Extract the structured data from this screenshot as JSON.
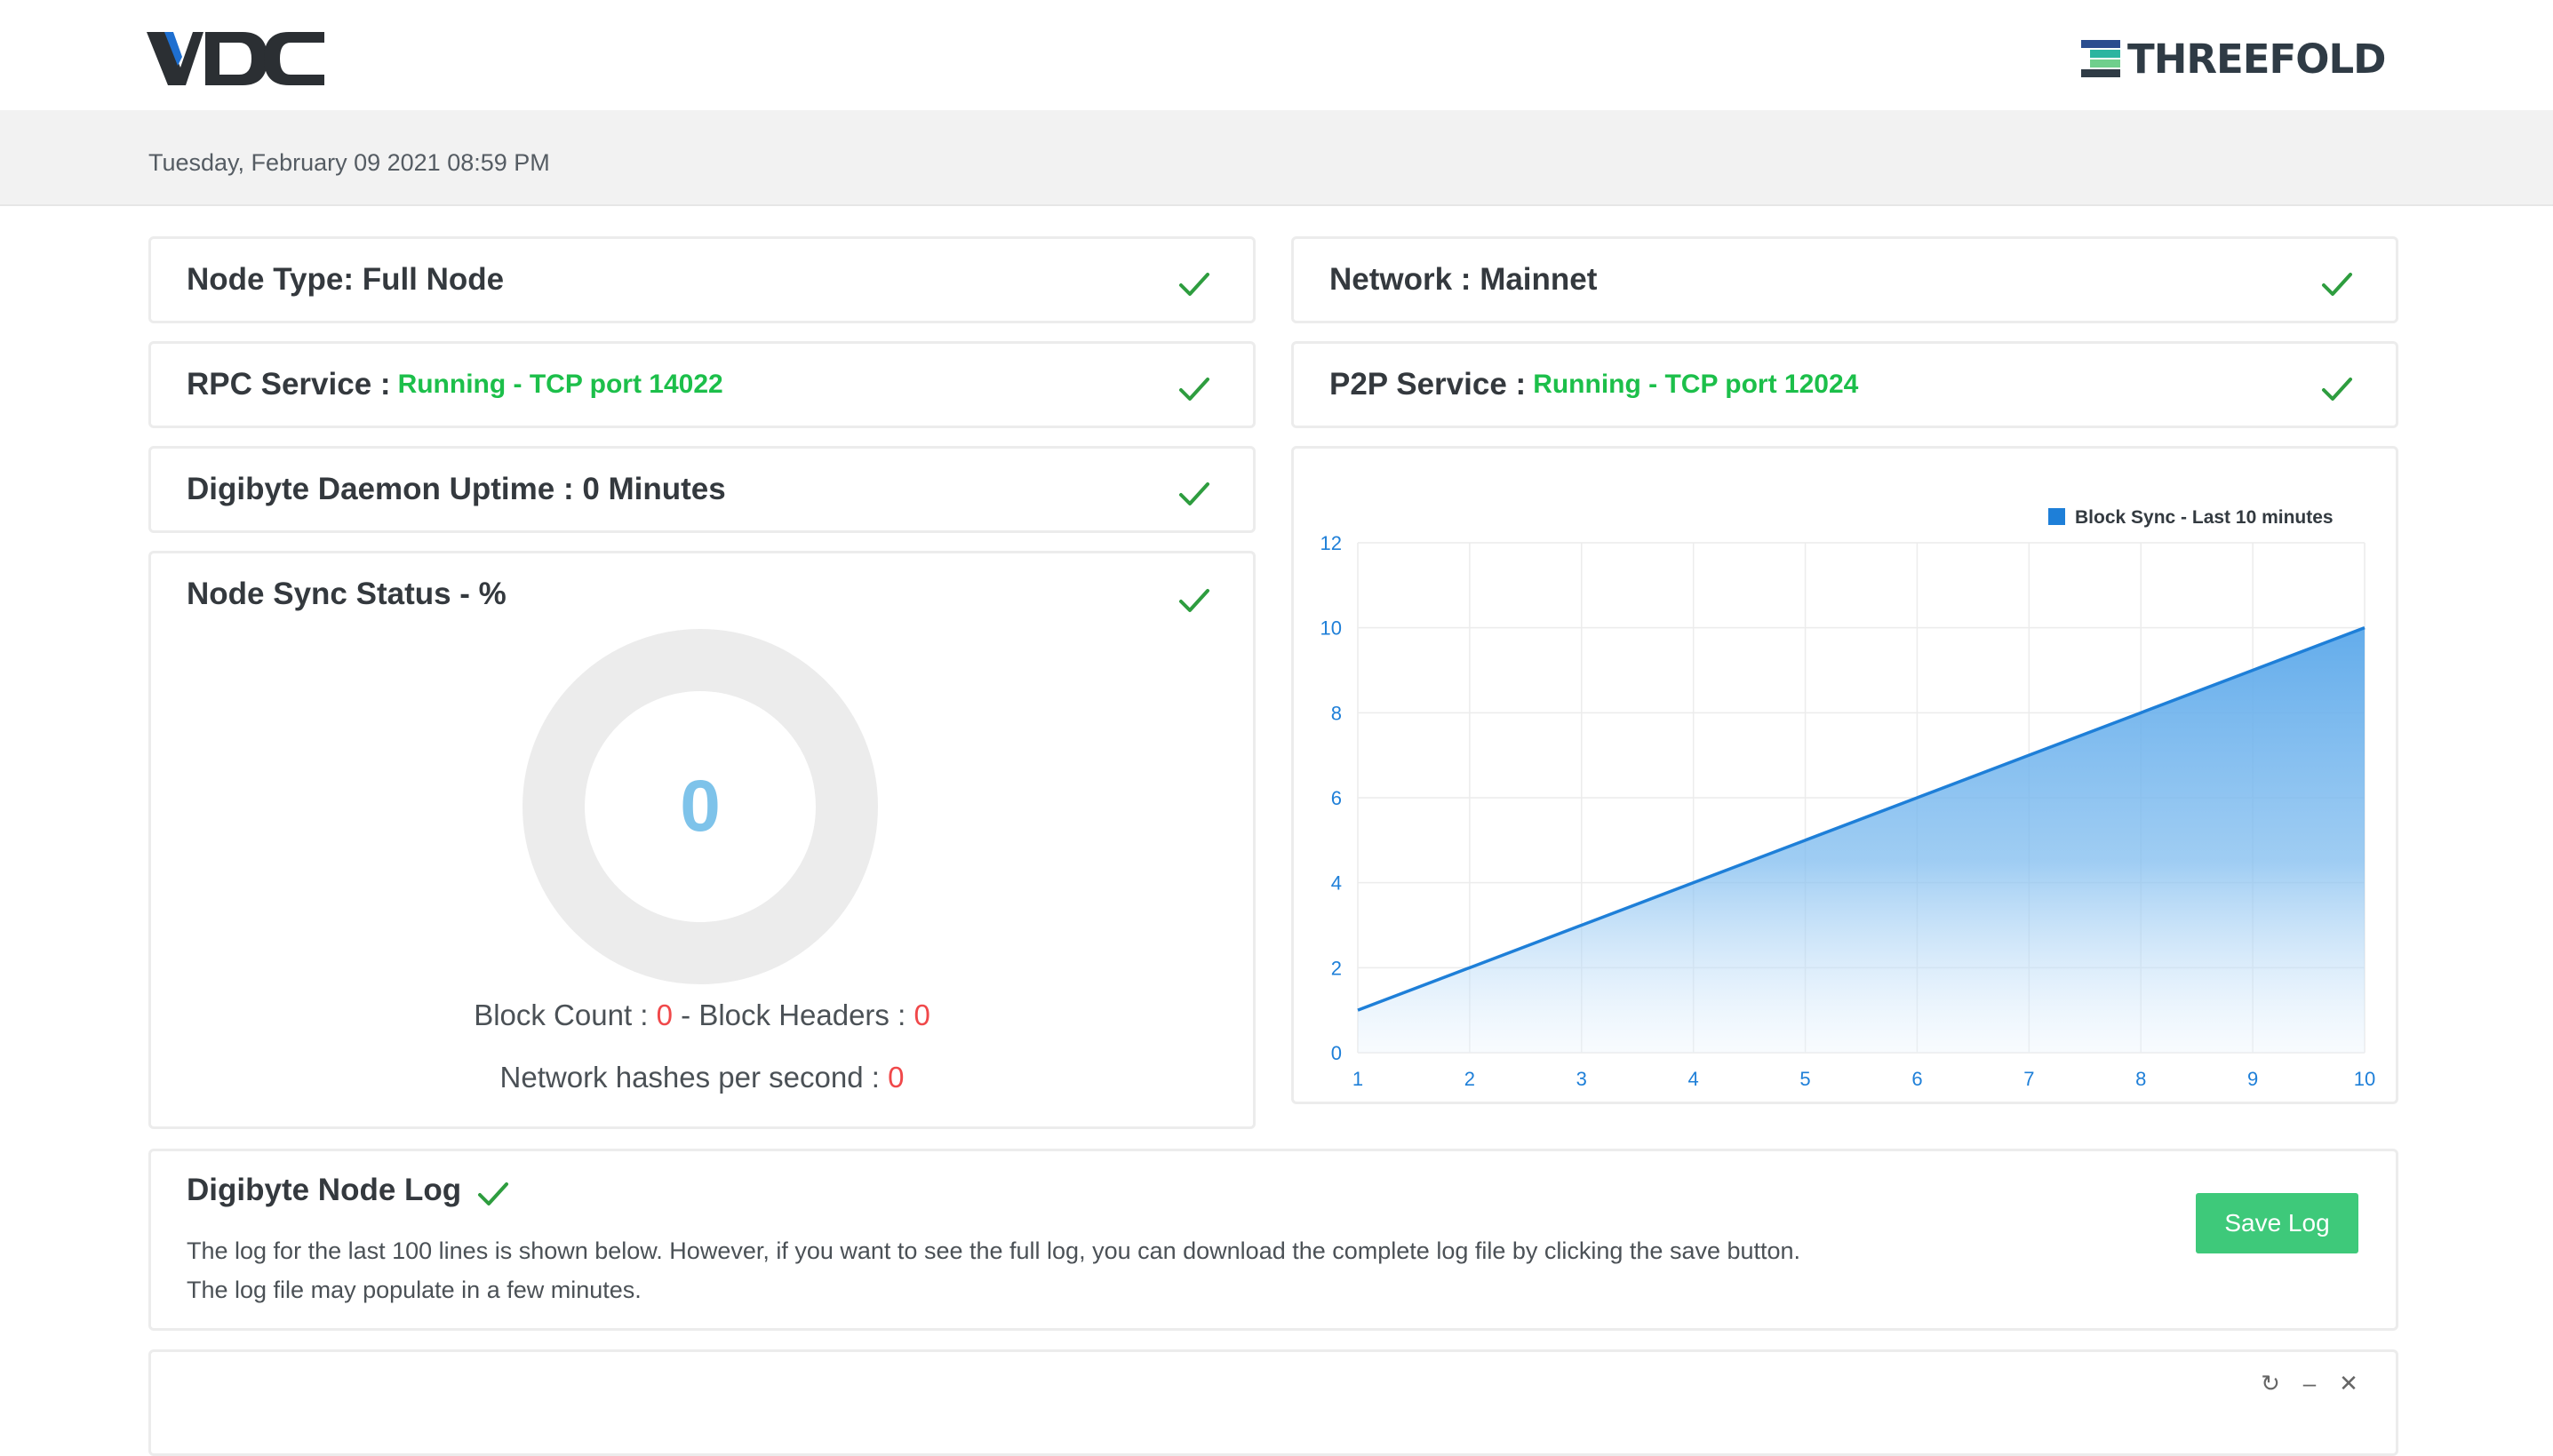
{
  "brand": {
    "vdc_logo": "VDC",
    "threefold_logo": "THREEFOLD"
  },
  "header": {
    "datetime": "Tuesday, February 09 2021 08:59 PM"
  },
  "status": {
    "node_type": "Node Type: Full Node",
    "network": "Network : Mainnet",
    "rpc_label": "RPC Service :",
    "rpc_value": "Running - TCP port 14022",
    "p2p_label": "P2P Service :",
    "p2p_value": "Running - TCP port 12024",
    "uptime": "Digibyte Daemon Uptime : 0 Minutes"
  },
  "sync": {
    "title": "Node Sync Status - %",
    "percent": "0",
    "percent_value": 0,
    "block_count_label": "Block Count :",
    "block_count": "0",
    "separator": "-",
    "block_headers_label": "Block Headers :",
    "block_headers": "0",
    "hashes_label": "Network hashes per second :",
    "hashes": "0"
  },
  "log": {
    "title": "Digibyte Node Log",
    "line1": "The log for the last 100 lines is shown below. However, if you want to see the full log, you can download the complete log file by clicking the save button.",
    "line2": "The log file may populate in a few minutes.",
    "save_label": "Save Log"
  },
  "colors": {
    "accent_green": "#1cbf4a",
    "button_green": "#3ec97a",
    "check_green": "#2e9d3f",
    "chart_blue": "#1e7fd8",
    "value_red": "#f0484a",
    "donut_grey": "#ececec",
    "donut_number": "#7ec3ea"
  },
  "icons": {
    "status_check": "check-icon",
    "window_controls": [
      "refresh-icon",
      "minimize-icon",
      "close-icon"
    ]
  },
  "chart_data": {
    "type": "area",
    "legend": "Block Sync - Last 10 minutes",
    "legend_position": "top-right",
    "x": [
      1,
      2,
      3,
      4,
      5,
      6,
      7,
      8,
      9,
      10
    ],
    "series": [
      {
        "name": "Block Sync - Last 10 minutes",
        "values": [
          1,
          2,
          3,
          4,
          5,
          6,
          7,
          8,
          9,
          10
        ]
      }
    ],
    "yticks": [
      0,
      2,
      4,
      6,
      8,
      10,
      12
    ],
    "ylim": [
      0,
      12
    ],
    "xlim": [
      1,
      10
    ],
    "grid": true
  }
}
